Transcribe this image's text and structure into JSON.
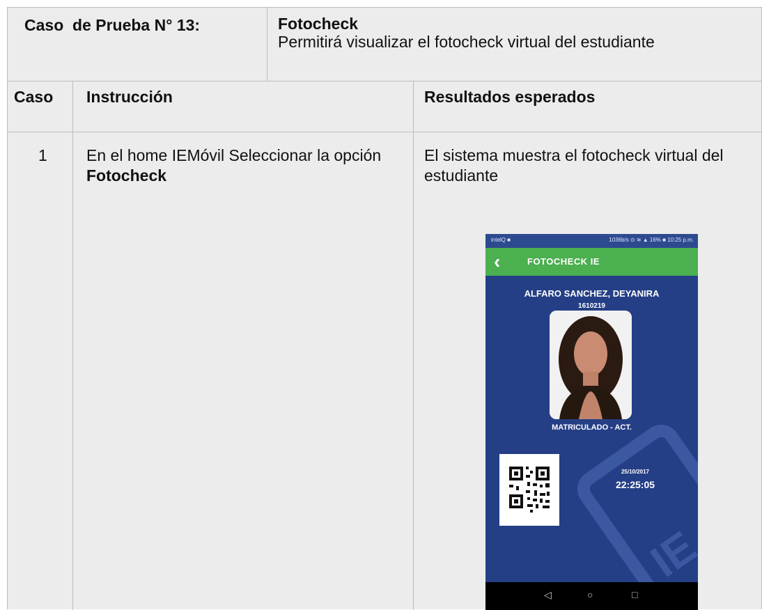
{
  "header": {
    "case_label": "Caso  de Prueba N° 13:",
    "title": "Fotocheck",
    "description": "Permitirá visualizar el fotocheck virtual del estudiante"
  },
  "table": {
    "columns": [
      "Caso",
      "Instrucción",
      "Resultados esperados"
    ],
    "rows": [
      {
        "caso": "1",
        "instruccion_text": "En el home IEMóvil Seleccionar la opción ",
        "instruccion_bold": "Fotocheck",
        "resultado": "El sistema muestra el fotocheck virtual del estudiante"
      }
    ]
  },
  "screenshot": {
    "status_left": "intelQ ■",
    "status_right": "1036b/s ⊙ ≋ ▲ 16% ■ 10:25 p.m.",
    "app_title": "FOTOCHECK IE",
    "back_icon": "chevron-left-icon",
    "student_name": "ALFARO SANCHEZ, DEYANIRA",
    "student_code": "1610219",
    "status": "MATRICULADO - ACT.",
    "date": "25/10/2017",
    "time": "22:25:05",
    "colors": {
      "app_bar": "#4caf50",
      "background": "#253f86"
    }
  }
}
